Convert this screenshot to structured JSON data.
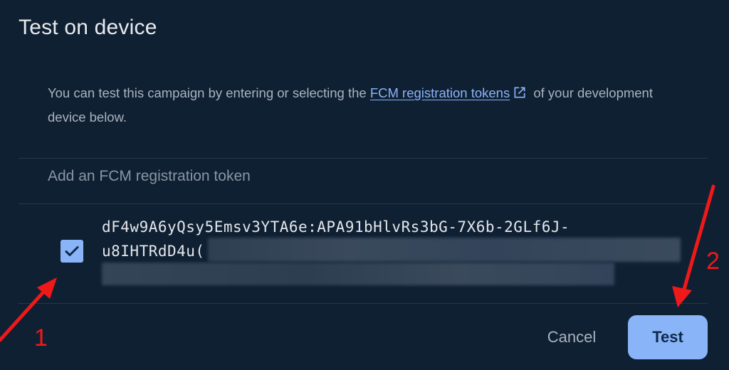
{
  "dialog": {
    "title": "Test on device",
    "description_before": "You can test this campaign by entering or selecting the ",
    "link_text": "FCM registration tokens",
    "description_after": " of your development device below.",
    "token_input_placeholder": "Add an FCM registration token",
    "token_line_1": "dF4w9A6yQsy5Emsv3YTA6e:APA91bHlvRs3bG-7X6b-2GLf6J-",
    "token_line_2": "u8IHTRdD4u(",
    "token_checked": true,
    "cancel_label": "Cancel",
    "test_label": "Test"
  },
  "annotations": {
    "label_1": "1",
    "label_2": "2"
  },
  "colors": {
    "background": "#0f2033",
    "accent": "#8ab4f8",
    "annotation": "#f01919"
  },
  "icons": {
    "external_link": "open-in-new-icon",
    "checkbox": "checkmark-icon"
  }
}
